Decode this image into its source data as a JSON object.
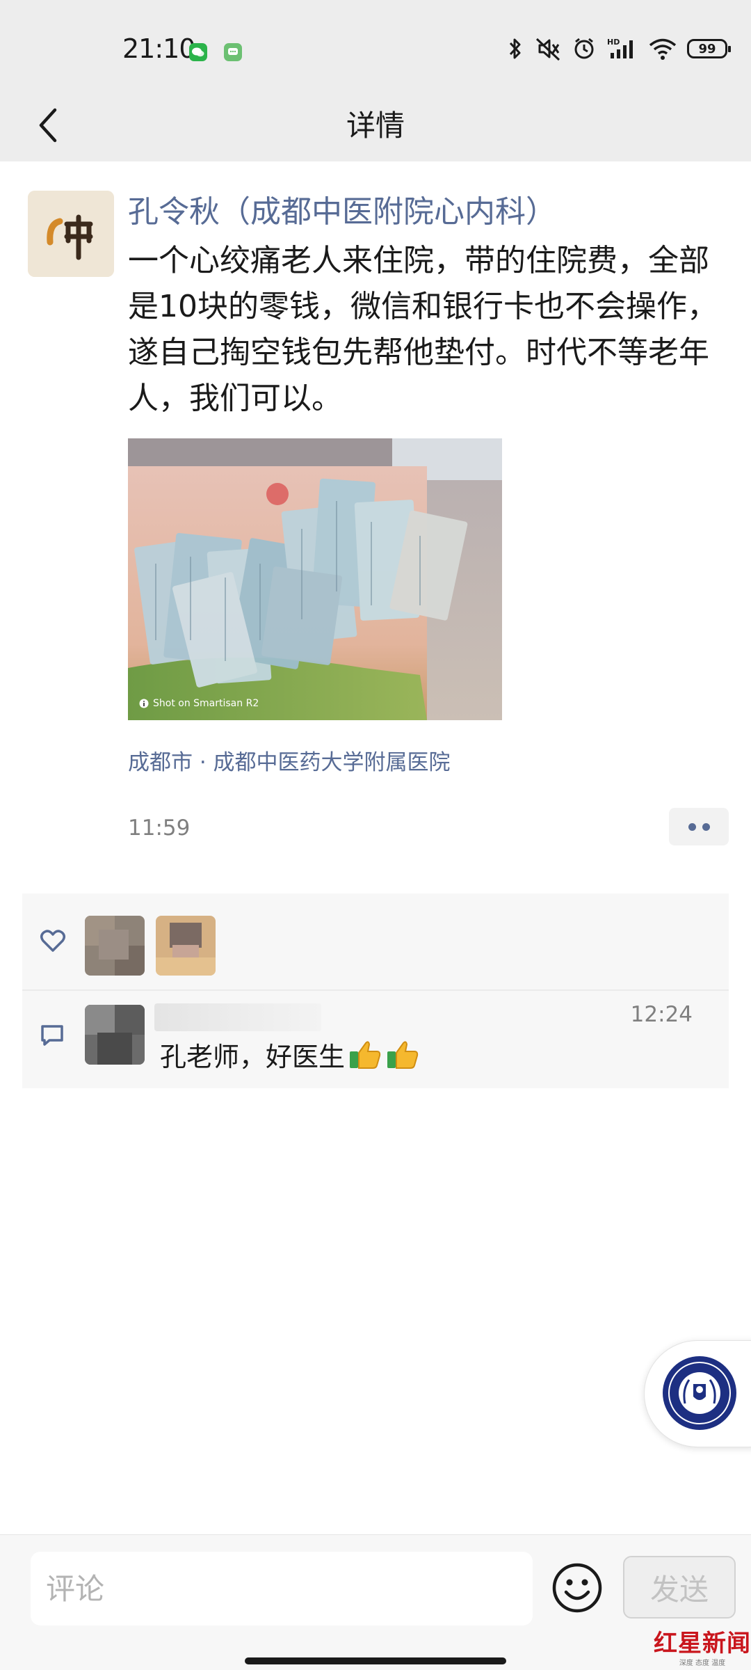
{
  "status_bar": {
    "time": "21:10",
    "app_icons": [
      "wechat-icon",
      "messages-icon"
    ],
    "right_icons": [
      "bluetooth-icon",
      "mute-icon",
      "alarm-icon",
      "hd-signal-icon",
      "wifi-icon"
    ],
    "battery": "99"
  },
  "nav": {
    "title": "详情"
  },
  "post": {
    "author": "孔令秋（成都中医附院心内科）",
    "text": "一个心绞痛老人来住院，带的住院费，全部是10块的零钱，微信和银行卡也不会操作，遂自己掏空钱包先帮他垫付。时代不等老年人，我们可以。",
    "photo_caption": "Shot on Smartisan R2",
    "location": "成都市 · 成都中医药大学附属医院",
    "time": "11:59"
  },
  "interactions": {
    "likes_icon": "heart-icon",
    "comment_icon": "comment-icon",
    "comments": [
      {
        "time": "12:24",
        "text": "孔老师，好医生"
      }
    ]
  },
  "bottom": {
    "comment_placeholder": "评论",
    "send_label": "发送",
    "watermark": "红星新闻",
    "watermark_sub": "深度 态度 温度"
  },
  "colors": {
    "link": "#576b95",
    "header_bg": "#ededed",
    "watermark_red": "#c9161d"
  }
}
